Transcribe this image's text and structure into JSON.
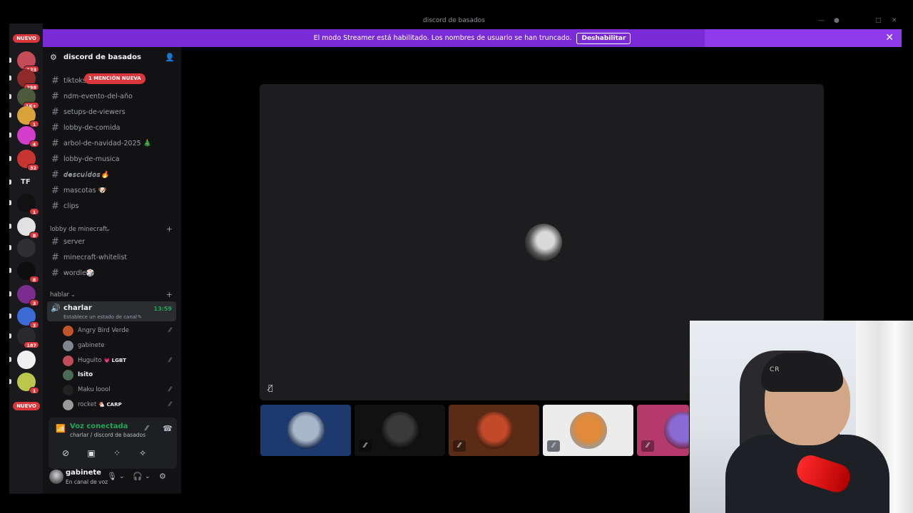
{
  "window": {
    "title": "discord de basados"
  },
  "banner": {
    "message": "El modo Streamer está habilitado. Los nombres de usuario se han truncado.",
    "button": "Deshabilitar"
  },
  "rail": {
    "nuevo_top": "NUEVO",
    "nuevo_bottom": "NUEVO",
    "servers": [
      {
        "badge": "123",
        "color": "#c44b58"
      },
      {
        "badge": "298",
        "color": "#8e2a2a"
      },
      {
        "badge": "1K+",
        "color": "#4a5a3a"
      },
      {
        "badge": "1",
        "color": "#d9a23b"
      },
      {
        "badge": "4",
        "color": "#d23ec9"
      },
      {
        "badge": "32",
        "color": "#c8342f"
      },
      {
        "badge": "",
        "label": "TF",
        "color": "#1a1a1e"
      },
      {
        "badge": "1",
        "color": "#111111"
      },
      {
        "badge": "8",
        "color": "#e1e1e1"
      },
      {
        "badge": "",
        "color": "#2f2f33"
      },
      {
        "badge": "8",
        "color": "#0e0e0e"
      },
      {
        "badge": "3",
        "color": "#7a2d8f"
      },
      {
        "badge": "3",
        "color": "#3c6bd6"
      },
      {
        "badge": "187",
        "color": "#2a2a2e"
      },
      {
        "badge": "",
        "color": "#f0f0f0"
      },
      {
        "badge": "1",
        "color": "#b9c74a"
      }
    ]
  },
  "sidebar": {
    "server_name": "discord de basados",
    "mention_badge": "1 MENCIÓN NUEVA",
    "channels": [
      {
        "name": "tiktoks",
        "style": "normal"
      },
      {
        "name": "ndm-evento-del-año",
        "style": "normal"
      },
      {
        "name": "setups-de-viewers",
        "style": "normal"
      },
      {
        "name": "lobby-de-comida",
        "style": "normal"
      },
      {
        "name": "arbol-de-navidad-2025 🎄",
        "style": "normal"
      },
      {
        "name": "lobby-de-musica",
        "style": "normal"
      },
      {
        "name": "𝘥𝘦𝘴𝘤𝘶𝘪𝘥𝘰𝘴🔥",
        "style": "italic"
      },
      {
        "name": "mascotas 🐶",
        "style": "normal"
      },
      {
        "name": "clips",
        "style": "normal"
      }
    ],
    "category_minecraft": "lobby de minecraft",
    "minecraft_channels": [
      "server",
      "minecraft-whitelist",
      "wordle🎲"
    ],
    "category_hablar": "hablar",
    "voice_channel": {
      "name": "charlar",
      "status": "Establece un estado de canal",
      "time": "13:59"
    },
    "voice_users": [
      {
        "name": "Angry Bird Verde",
        "tag": "",
        "muted": true,
        "active": false,
        "color": "#c2542b"
      },
      {
        "name": "gabinete",
        "tag": "",
        "muted": false,
        "active": false,
        "color": "#7d858f"
      },
      {
        "name": "Huguito",
        "tag": "💗 LGBT",
        "muted": true,
        "active": false,
        "color": "#c14d5a"
      },
      {
        "name": "Isito",
        "tag": "",
        "muted": false,
        "active": true,
        "color": "#4a6a55"
      },
      {
        "name": "Maku loool",
        "tag": "",
        "muted": true,
        "active": false,
        "color": "#222222"
      },
      {
        "name": "rocket",
        "tag": "🐔 CARP",
        "muted": true,
        "active": false,
        "color": "#999999"
      }
    ]
  },
  "voice_panel": {
    "title": "Voz conectada",
    "subtitle": "charlar / discord de basados"
  },
  "user_panel": {
    "name": "gabinete",
    "status": "En canal de voz"
  },
  "stage": {
    "tiles": [
      {
        "bg": "#1c3a6e",
        "av": "#a9b5c9",
        "muted": false
      },
      {
        "bg": "#111111",
        "av": "#3a3a3a",
        "muted": true
      },
      {
        "bg": "#5a2c16",
        "av": "#c24a2a",
        "muted": true
      },
      {
        "bg": "#ececec",
        "av": "#e08a3a",
        "muted": true
      },
      {
        "bg": "#b33a6a",
        "av": "#8a6bd6",
        "muted": true
      }
    ]
  },
  "webcam": {
    "brand": "CR"
  }
}
